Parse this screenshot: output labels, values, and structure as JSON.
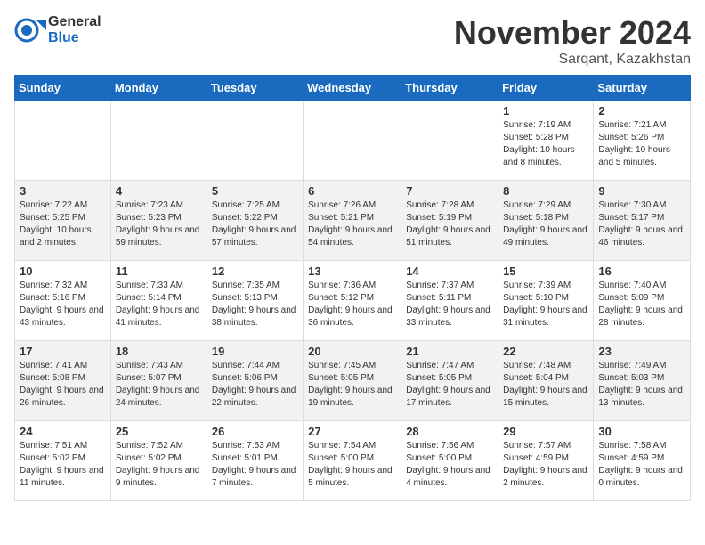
{
  "logo": {
    "line1": "General",
    "line2": "Blue"
  },
  "title": "November 2024",
  "location": "Sarqant, Kazakhstan",
  "weekdays": [
    "Sunday",
    "Monday",
    "Tuesday",
    "Wednesday",
    "Thursday",
    "Friday",
    "Saturday"
  ],
  "weeks": [
    [
      {
        "day": "",
        "info": ""
      },
      {
        "day": "",
        "info": ""
      },
      {
        "day": "",
        "info": ""
      },
      {
        "day": "",
        "info": ""
      },
      {
        "day": "",
        "info": ""
      },
      {
        "day": "1",
        "info": "Sunrise: 7:19 AM\nSunset: 5:28 PM\nDaylight: 10 hours and 8 minutes."
      },
      {
        "day": "2",
        "info": "Sunrise: 7:21 AM\nSunset: 5:26 PM\nDaylight: 10 hours and 5 minutes."
      }
    ],
    [
      {
        "day": "3",
        "info": "Sunrise: 7:22 AM\nSunset: 5:25 PM\nDaylight: 10 hours and 2 minutes."
      },
      {
        "day": "4",
        "info": "Sunrise: 7:23 AM\nSunset: 5:23 PM\nDaylight: 9 hours and 59 minutes."
      },
      {
        "day": "5",
        "info": "Sunrise: 7:25 AM\nSunset: 5:22 PM\nDaylight: 9 hours and 57 minutes."
      },
      {
        "day": "6",
        "info": "Sunrise: 7:26 AM\nSunset: 5:21 PM\nDaylight: 9 hours and 54 minutes."
      },
      {
        "day": "7",
        "info": "Sunrise: 7:28 AM\nSunset: 5:19 PM\nDaylight: 9 hours and 51 minutes."
      },
      {
        "day": "8",
        "info": "Sunrise: 7:29 AM\nSunset: 5:18 PM\nDaylight: 9 hours and 49 minutes."
      },
      {
        "day": "9",
        "info": "Sunrise: 7:30 AM\nSunset: 5:17 PM\nDaylight: 9 hours and 46 minutes."
      }
    ],
    [
      {
        "day": "10",
        "info": "Sunrise: 7:32 AM\nSunset: 5:16 PM\nDaylight: 9 hours and 43 minutes."
      },
      {
        "day": "11",
        "info": "Sunrise: 7:33 AM\nSunset: 5:14 PM\nDaylight: 9 hours and 41 minutes."
      },
      {
        "day": "12",
        "info": "Sunrise: 7:35 AM\nSunset: 5:13 PM\nDaylight: 9 hours and 38 minutes."
      },
      {
        "day": "13",
        "info": "Sunrise: 7:36 AM\nSunset: 5:12 PM\nDaylight: 9 hours and 36 minutes."
      },
      {
        "day": "14",
        "info": "Sunrise: 7:37 AM\nSunset: 5:11 PM\nDaylight: 9 hours and 33 minutes."
      },
      {
        "day": "15",
        "info": "Sunrise: 7:39 AM\nSunset: 5:10 PM\nDaylight: 9 hours and 31 minutes."
      },
      {
        "day": "16",
        "info": "Sunrise: 7:40 AM\nSunset: 5:09 PM\nDaylight: 9 hours and 28 minutes."
      }
    ],
    [
      {
        "day": "17",
        "info": "Sunrise: 7:41 AM\nSunset: 5:08 PM\nDaylight: 9 hours and 26 minutes."
      },
      {
        "day": "18",
        "info": "Sunrise: 7:43 AM\nSunset: 5:07 PM\nDaylight: 9 hours and 24 minutes."
      },
      {
        "day": "19",
        "info": "Sunrise: 7:44 AM\nSunset: 5:06 PM\nDaylight: 9 hours and 22 minutes."
      },
      {
        "day": "20",
        "info": "Sunrise: 7:45 AM\nSunset: 5:05 PM\nDaylight: 9 hours and 19 minutes."
      },
      {
        "day": "21",
        "info": "Sunrise: 7:47 AM\nSunset: 5:05 PM\nDaylight: 9 hours and 17 minutes."
      },
      {
        "day": "22",
        "info": "Sunrise: 7:48 AM\nSunset: 5:04 PM\nDaylight: 9 hours and 15 minutes."
      },
      {
        "day": "23",
        "info": "Sunrise: 7:49 AM\nSunset: 5:03 PM\nDaylight: 9 hours and 13 minutes."
      }
    ],
    [
      {
        "day": "24",
        "info": "Sunrise: 7:51 AM\nSunset: 5:02 PM\nDaylight: 9 hours and 11 minutes."
      },
      {
        "day": "25",
        "info": "Sunrise: 7:52 AM\nSunset: 5:02 PM\nDaylight: 9 hours and 9 minutes."
      },
      {
        "day": "26",
        "info": "Sunrise: 7:53 AM\nSunset: 5:01 PM\nDaylight: 9 hours and 7 minutes."
      },
      {
        "day": "27",
        "info": "Sunrise: 7:54 AM\nSunset: 5:00 PM\nDaylight: 9 hours and 5 minutes."
      },
      {
        "day": "28",
        "info": "Sunrise: 7:56 AM\nSunset: 5:00 PM\nDaylight: 9 hours and 4 minutes."
      },
      {
        "day": "29",
        "info": "Sunrise: 7:57 AM\nSunset: 4:59 PM\nDaylight: 9 hours and 2 minutes."
      },
      {
        "day": "30",
        "info": "Sunrise: 7:58 AM\nSunset: 4:59 PM\nDaylight: 9 hours and 0 minutes."
      }
    ]
  ]
}
